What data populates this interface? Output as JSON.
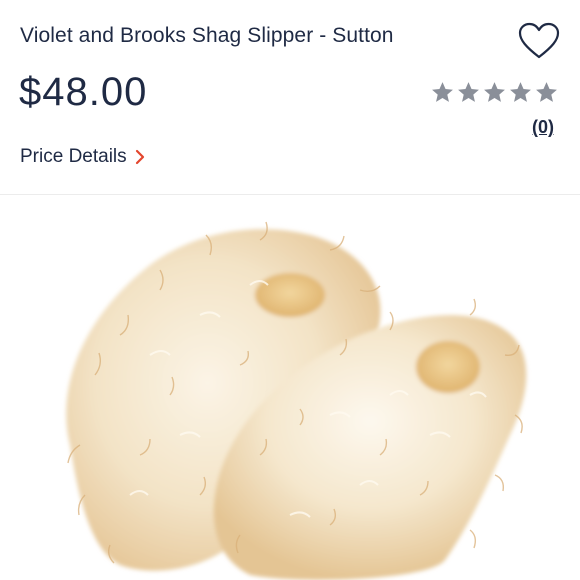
{
  "listing": {
    "title": "Violet and Brooks Shag Slipper - Sutton",
    "price": "$48.00",
    "rating": {
      "stars_filled": 0,
      "stars_total": 5,
      "review_count": "(0)"
    },
    "price_details_label": "Price Details"
  },
  "colors": {
    "text_navy": "#1f2a44",
    "star_gray": "#8a8f99",
    "accent_red": "#e3462d",
    "fur_cream": "#f6ead2",
    "fur_tan": "#e2c08e"
  },
  "icons": {
    "like": "heart-outline-icon",
    "rating": "star-icon",
    "details": "chevron-right-icon"
  }
}
